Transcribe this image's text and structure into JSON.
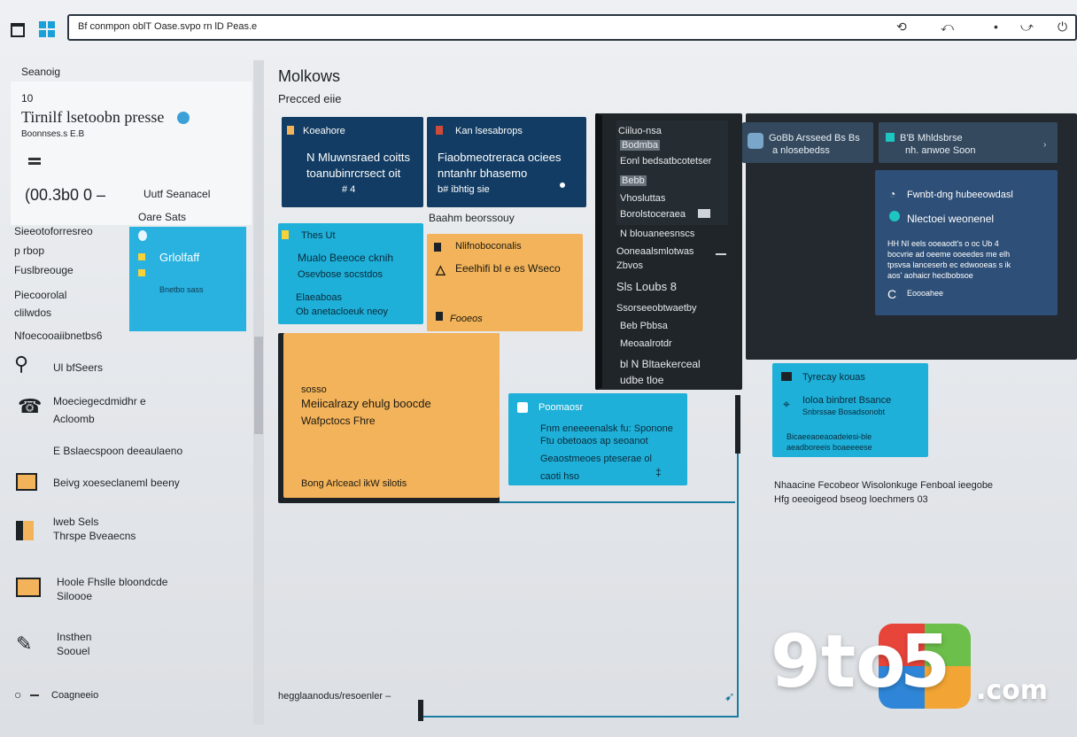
{
  "topbar": {
    "address": "Bf conmpon oblT Oase.svpo rn lD Peas.e",
    "controls": [
      "⟲",
      "⤺",
      "•",
      "⤻",
      "⏻"
    ]
  },
  "sidebar": {
    "section_label": "Seanoig",
    "summary": {
      "small_number": "10",
      "title": "Tirnilf lsetoobn presse",
      "subtitle": "Boonnses.s E.B",
      "metric": "(00.3b0 0 –",
      "metric_label_1": "Uutf Seanacel",
      "metric_label_2": "Oare Sats"
    },
    "tile": {
      "label": "Grlolfaff",
      "sublabel": "Bnetbo sass"
    },
    "labels": [
      "Sieeotoforresreo",
      "p rbop",
      "Fuslbreouge",
      "Piecoorolal",
      "clilwdos",
      "Nfoecooaiibnetbs6"
    ],
    "nav_items": [
      {
        "icon": "key-icon",
        "glyph": "⚲",
        "line1": "Ul bfSeers",
        "line2": ""
      },
      {
        "icon": "phone-icon",
        "glyph": "☎",
        "line1": "Moeciegecdmidhr e",
        "line2": "Acloomb"
      },
      {
        "icon": "",
        "glyph": "",
        "line1": "E Bslaecspoon deeaulaeno",
        "line2": ""
      },
      {
        "icon": "folder-icon",
        "glyph": "▭",
        "line1": "Beivg xoeseclaneml beeny",
        "line2": ""
      },
      {
        "icon": "book-icon",
        "glyph": "▮",
        "line1": "lweb Sels",
        "line2": "Thrspe Bveaecns"
      },
      {
        "icon": "chat-icon",
        "glyph": "▭",
        "line1": "Hoole Fhslle bloondcde",
        "line2": "Siloooe"
      },
      {
        "icon": "pen-icon",
        "glyph": "✎",
        "line1": "Insthen",
        "line2": "Soouel"
      },
      {
        "icon": "circle-icon",
        "glyph": "○",
        "line1": "Coagneeio",
        "line2": ""
      }
    ]
  },
  "main": {
    "title": "Molkows",
    "subtitle": "Precced eiie",
    "cards": {
      "navy1": {
        "title": "Koeahore",
        "line1": "N Mluwnsraed coitts",
        "line2": "toanubinrcrsect oit",
        "line3": "# 4"
      },
      "navy2": {
        "title": "Kan lsesabrops",
        "line1": "Fiaobmeotreraca ociees",
        "line2": "nntanhr bhasemo",
        "line3": "b# ibhtig sie"
      },
      "below_navy2": "Baahm beorssouy",
      "cyan1": {
        "title": "Thes Ut",
        "line1": "Mualo Beeoce cknih",
        "line2": "Osevbose socstdos",
        "line3": "Elaeaboas",
        "line4": "Ob anetacloeuk neoy"
      },
      "orange1": {
        "title": "Nlifnoboconalis",
        "line1": "Eeelhifi bI e es Wseco",
        "line2": "Fooeos"
      },
      "orange_big": {
        "small": "sosso",
        "line1": "Meiicalrazy ehulg boocde",
        "line2": "Wafpctocs Fhre",
        "footer": "Bong Arlceacl ikW silotis"
      },
      "cyan2": {
        "title": "Poomaosr",
        "line1": "Fnm eneeeenalsk fu: Sponone",
        "line2": "Ftu obetoaos ap seoanot",
        "line3": "Geaostmeoes pteserae ol",
        "line4": "caoti hso",
        "line5": "‡"
      },
      "dark_panel": {
        "items": [
          "Ciiluo-nsa",
          "Bodmba",
          "Eonl bedsatbcotetser",
          "Bebb",
          "Vhosluttas",
          "Borolstoceraea",
          "N blouaneesnscs",
          "Ooneaalsmlotwas",
          "Zbvos",
          "Sls Loubs 8",
          "Ssorseeobtwaetby",
          "Beb Pbbsa",
          "Meoaalrotdr",
          "bl N Bltaekerceal",
          "udbe tloe"
        ]
      },
      "slate_top": {
        "line1": "GoBb Arsseed Bs Bs",
        "line2": "a nlosebedss"
      },
      "slate_top2": {
        "line1": "B'B Mhldsbrse",
        "line2": "nh. anwoe Soon"
      },
      "bluegrey": {
        "title": "Fwnbt-dng hubeeowdasl",
        "subtitle": "Nlectoei weonenel",
        "line1": "HH NI eels ooeaodt's o oc Ub 4",
        "line2": "bocvrie ad oeeme ooeedes me elh",
        "line3": "tpsvsa lanceserb ec edwooeas s ik",
        "line4": "aos' aohaicr heclbobsoe",
        "line5": "Eoooahee"
      },
      "cyan3": {
        "title": "Tyrecay kouas",
        "line1": "Ioloa binbret Bsance",
        "line2": "Snbrssae Bosadsonobt",
        "line3": "Bicaeeaoeaoadeiesi-ble",
        "line4": "aeadboreeis boaeeeese"
      },
      "caption": {
        "line1": "Nhaacine Fecobeor Wisolonkuge Fenboal ieegobe",
        "line2": "Hfg oeeoigeod bseog loechmers 03"
      },
      "bottom_label": "hegglaanodus/resoenler –"
    }
  },
  "watermark": {
    "part1": "9to",
    "part2": "5",
    "suffix": ".com"
  },
  "colors": {
    "navy": "#123c63",
    "cyan": "#1eb0d8",
    "orange": "#f2b35a",
    "dark": "#1f2529",
    "accent_line": "#1a7ca3"
  }
}
